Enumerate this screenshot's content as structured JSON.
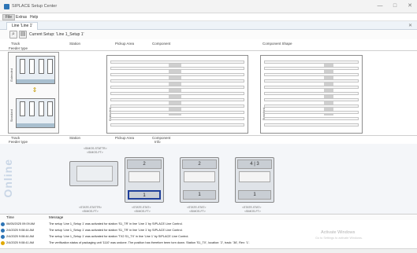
{
  "window": {
    "title": "SIPLACE Setup Center",
    "controls": [
      "—",
      "□",
      "✕"
    ]
  },
  "menu": {
    "items": [
      "File",
      "Extras",
      "Help"
    ]
  },
  "tab": {
    "label": "Line 'Line 1'"
  },
  "toolbar": {
    "current_setup": "Current Setup: 'Line 1_Setup 1'"
  },
  "columns_top": {
    "track": "Track",
    "station": "Station",
    "pickup_area": "Pickup Area",
    "component": "Component",
    "component_shape": "Component Shape",
    "feeder_type": "Feeder type"
  },
  "columns_bottom": {
    "track": "Track",
    "station": "Station",
    "pickup_area": "Pickup Area",
    "component": "Component",
    "feeder_type": "Feeder type",
    "info": "Info"
  },
  "side_labels": {
    "extended": "Extended",
    "standard": "Standard"
  },
  "online": {
    "label": "Online",
    "top_addr": "<SIMOS-STATTR>",
    "top_addr2": "<SIMOS-FT>",
    "modules": [
      {
        "head": "",
        "foot": "",
        "label_top": "",
        "label_bottom": "<STATE-STATTR>",
        "label_bottom2": "<SIMOS-FT>"
      },
      {
        "head": "2",
        "foot": "1",
        "label_top": "",
        "label_bottom": "<STATE-STAT>",
        "label_bottom2": "<SIMOS-FT>"
      },
      {
        "head": "2",
        "foot": "1",
        "label_top": "",
        "label_bottom": "<STATE-STAT>",
        "label_bottom2": "<SIMOS-FT>"
      },
      {
        "head": "4 | 3",
        "foot": "1",
        "label_top": "",
        "label_bottom": "<STATE-STAT>",
        "label_bottom2": "<SIMOS-FT>"
      }
    ]
  },
  "log": {
    "header_time": "Time",
    "header_message": "Message",
    "rows": [
      {
        "time": "06/05/2025 09:09 AM",
        "status": "#2e75b6",
        "message": "The setup 'Line 1_Setup 1' was activated for station 'S1_TR' in line 'Line 1' by SIPLACE Line Control."
      },
      {
        "time": "2/4/2025 9:08:44 AM",
        "status": "#2e75b6",
        "message": "The setup 'Line 1_Setup 1' was activated for station 'S1_TR' in line 'Line 1' by SIPLACE Line Control."
      },
      {
        "time": "2/4/2025 9:08:44 AM",
        "status": "#2e75b6",
        "message": "The setup 'Line 1_Setup 1' was activated for station 'TX2 S1_TX' in line 'Line 1' by SIPLACE Line Control."
      },
      {
        "time": "2/4/2025 9:08:41 AM",
        "status": "#e0a800",
        "message": "The verification status of packaging unit '1110' was undone. The position has therefore been torn down. Station 'S1_TX', location: '2', track: '36', Rev: '1'."
      }
    ]
  },
  "watermark": {
    "title": "Activate Windows",
    "subtitle": "Go to Settings to activate Windows."
  },
  "colors": {
    "accent": "#2e75b6",
    "selected_border": "#1f3f9a",
    "online_text": "#c9d6e6"
  }
}
